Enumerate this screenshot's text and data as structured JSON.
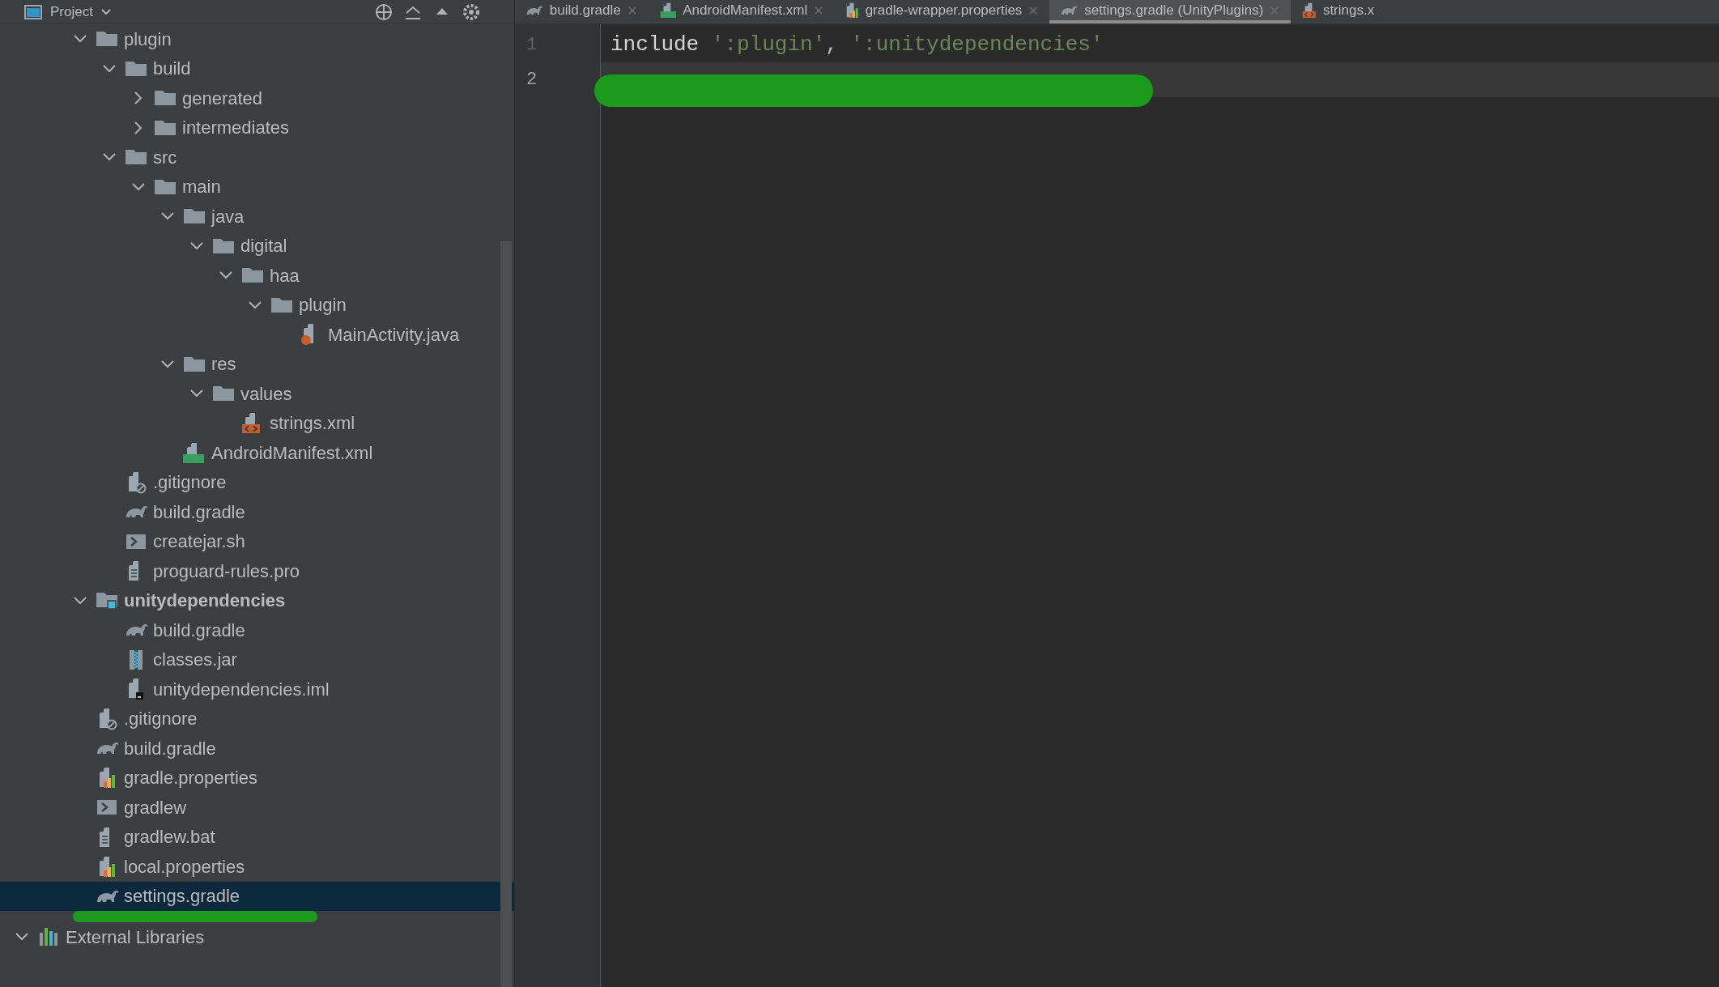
{
  "project_panel": {
    "title": "Project"
  },
  "tabs": [
    {
      "label": "build.gradle",
      "kind": "gradle",
      "selected": false
    },
    {
      "label": "AndroidManifest.xml",
      "kind": "manifest",
      "selected": false
    },
    {
      "label": "gradle-wrapper.properties",
      "kind": "properties",
      "selected": false
    },
    {
      "label": "settings.gradle (UnityPlugins)",
      "kind": "gradle",
      "selected": true
    },
    {
      "label": "strings.x",
      "kind": "xml",
      "selected": false
    }
  ],
  "tree": {
    "items": [
      {
        "label": "plugin",
        "kind": "folder",
        "expanded": true,
        "selected": false,
        "children": [
          {
            "label": "build",
            "kind": "folder",
            "expanded": true,
            "selected": false,
            "children": [
              {
                "label": "generated",
                "kind": "folder",
                "expanded": false,
                "selected": false
              },
              {
                "label": "intermediates",
                "kind": "folder",
                "expanded": false,
                "selected": false
              }
            ]
          },
          {
            "label": "src",
            "kind": "folder",
            "expanded": true,
            "selected": false,
            "children": [
              {
                "label": "main",
                "kind": "folder",
                "expanded": true,
                "selected": false,
                "children": [
                  {
                    "label": "java",
                    "kind": "folder",
                    "expanded": true,
                    "selected": false,
                    "children": [
                      {
                        "label": "digital",
                        "kind": "folder",
                        "expanded": true,
                        "selected": false,
                        "children": [
                          {
                            "label": "haa",
                            "kind": "folder",
                            "expanded": true,
                            "selected": false,
                            "children": [
                              {
                                "label": "plugin",
                                "kind": "folder",
                                "expanded": true,
                                "selected": false,
                                "children": [
                                  {
                                    "label": "MainActivity.java",
                                    "kind": "java",
                                    "selected": false
                                  }
                                ]
                              }
                            ]
                          }
                        ]
                      }
                    ]
                  },
                  {
                    "label": "res",
                    "kind": "folder",
                    "expanded": true,
                    "selected": false,
                    "children": [
                      {
                        "label": "values",
                        "kind": "folder",
                        "expanded": true,
                        "selected": false,
                        "children": [
                          {
                            "label": "strings.xml",
                            "kind": "xml",
                            "selected": false
                          }
                        ]
                      }
                    ]
                  },
                  {
                    "label": "AndroidManifest.xml",
                    "kind": "manifest",
                    "selected": false
                  }
                ]
              }
            ]
          },
          {
            "label": ".gitignore",
            "kind": "gitignore",
            "selected": false
          },
          {
            "label": "build.gradle",
            "kind": "gradle",
            "selected": false
          },
          {
            "label": "createjar.sh",
            "kind": "shell",
            "selected": false
          },
          {
            "label": "proguard-rules.pro",
            "kind": "text",
            "selected": false
          }
        ]
      },
      {
        "label": "unitydependencies",
        "kind": "module",
        "expanded": true,
        "selected": false,
        "children": [
          {
            "label": "build.gradle",
            "kind": "gradle",
            "selected": false
          },
          {
            "label": "classes.jar",
            "kind": "jar",
            "selected": false
          },
          {
            "label": "unitydependencies.iml",
            "kind": "iml",
            "selected": false
          }
        ]
      },
      {
        "label": ".gitignore",
        "kind": "gitignore",
        "selected": false
      },
      {
        "label": "build.gradle",
        "kind": "gradle",
        "selected": false
      },
      {
        "label": "gradle.properties",
        "kind": "properties",
        "selected": false
      },
      {
        "label": "gradlew",
        "kind": "shell",
        "selected": false
      },
      {
        "label": "gradlew.bat",
        "kind": "text",
        "selected": false
      },
      {
        "label": "local.properties",
        "kind": "properties",
        "selected": false
      },
      {
        "label": "settings.gradle",
        "kind": "gradle",
        "selected": true
      }
    ]
  },
  "external_libraries": {
    "label": "External Libraries",
    "kind": "library",
    "expanded": true,
    "selected": false
  },
  "editor": {
    "lines": [
      {
        "number": "1",
        "current": false,
        "tokens": [
          {
            "kind": "keyword",
            "text": "include"
          },
          {
            "kind": "string",
            "text": "':plugin'"
          },
          {
            "kind": "plain",
            "text": ", "
          },
          {
            "kind": "string",
            "text": "':unitydependencies'"
          }
        ]
      },
      {
        "number": "2",
        "current": true
      }
    ]
  }
}
